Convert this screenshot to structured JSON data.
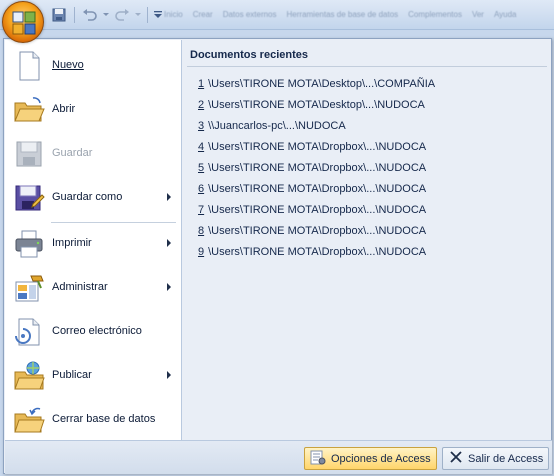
{
  "quick_access": {
    "icons": [
      "access-logo-icon",
      "save-icon",
      "undo-icon",
      "redo-icon",
      "customize-dropdown-icon"
    ],
    "blurred_tabs": [
      "Inicio",
      "Crear",
      "Datos externos",
      "Herramientas de base de datos",
      "Complementos",
      "Ver",
      "Ayuda"
    ]
  },
  "menu": {
    "items": [
      {
        "label": "Nuevo",
        "icon": "new-document-icon",
        "has_submenu": false,
        "enabled": true
      },
      {
        "label": "Abrir",
        "icon": "open-folder-icon",
        "has_submenu": false,
        "enabled": true
      },
      {
        "label": "Guardar",
        "icon": "save-icon",
        "has_submenu": false,
        "enabled": false
      },
      {
        "label": "Guardar como",
        "icon": "save-as-icon",
        "has_submenu": true,
        "enabled": true
      },
      {
        "label": "Imprimir",
        "icon": "print-icon",
        "has_submenu": true,
        "enabled": true
      },
      {
        "label": "Administrar",
        "icon": "manage-icon",
        "has_submenu": true,
        "enabled": true
      },
      {
        "label": "Correo electrónico",
        "icon": "email-icon",
        "has_submenu": false,
        "enabled": true
      },
      {
        "label": "Publicar",
        "icon": "publish-icon",
        "has_submenu": true,
        "enabled": true
      },
      {
        "label": "Cerrar base de datos",
        "icon": "close-database-icon",
        "has_submenu": false,
        "enabled": true
      }
    ]
  },
  "recent": {
    "title": "Documentos recientes",
    "items": [
      {
        "num": "1",
        "path": "\\Users\\TIRONE MOTA\\Desktop\\...\\COMPAÑIA"
      },
      {
        "num": "2",
        "path": "\\Users\\TIRONE MOTA\\Desktop\\...\\NUDOCA"
      },
      {
        "num": "3",
        "path": "\\\\Juancarlos-pc\\...\\NUDOCA"
      },
      {
        "num": "4",
        "path": "\\Users\\TIRONE MOTA\\Dropbox\\...\\NUDOCA"
      },
      {
        "num": "5",
        "path": "\\Users\\TIRONE MOTA\\Dropbox\\...\\NUDOCA"
      },
      {
        "num": "6",
        "path": "\\Users\\TIRONE MOTA\\Dropbox\\...\\NUDOCA"
      },
      {
        "num": "7",
        "path": "\\Users\\TIRONE MOTA\\Dropbox\\...\\NUDOCA"
      },
      {
        "num": "8",
        "path": "\\Users\\TIRONE MOTA\\Dropbox\\...\\NUDOCA"
      },
      {
        "num": "9",
        "path": "\\Users\\TIRONE MOTA\\Dropbox\\...\\NUDOCA"
      }
    ]
  },
  "footer": {
    "options_label": "Opciones de Access",
    "exit_label": "Salir de Access"
  },
  "colors": {
    "office_button": "#f5a21c",
    "menu_background": "#e9eef6",
    "highlight_button": "#ffd56b"
  }
}
